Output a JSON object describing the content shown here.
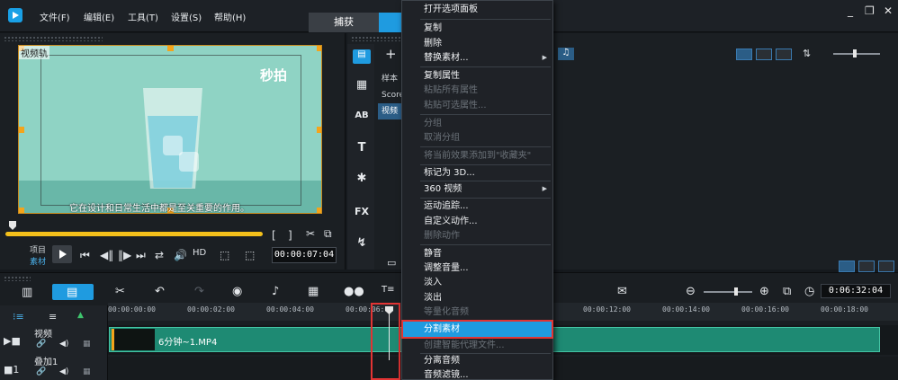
{
  "menubar": {
    "items": [
      "文件(F)",
      "编辑(E)",
      "工具(T)",
      "设置(S)",
      "帮助(H)"
    ],
    "step_tab": "捕获"
  },
  "player": {
    "track_label": "视频轨",
    "watermark": "秒拍",
    "subtitle": "它在设计和日常生活中都是至关重要的作用。",
    "mode_project": "项目",
    "mode_clip": "素材",
    "timecode": "00:00:07:04"
  },
  "library": {
    "list_items": [
      "样本",
      "Score",
      "视频"
    ],
    "selected_index": 2
  },
  "context_menu": {
    "items": [
      {
        "label": "打开选项面板",
        "disabled": false,
        "submenu": false
      },
      {
        "label": "复制",
        "disabled": false,
        "submenu": false
      },
      {
        "label": "删除",
        "disabled": false,
        "submenu": false
      },
      {
        "label": "替换素材...",
        "disabled": false,
        "submenu": true
      },
      {
        "label": "复制属性",
        "disabled": false,
        "submenu": false
      },
      {
        "label": "粘贴所有属性",
        "disabled": true,
        "submenu": false
      },
      {
        "label": "粘贴可选属性...",
        "disabled": true,
        "submenu": false
      },
      {
        "label": "分组",
        "disabled": true,
        "submenu": false
      },
      {
        "label": "取消分组",
        "disabled": true,
        "submenu": false
      },
      {
        "label": "将当前效果添加到\"收藏夹\"",
        "disabled": true,
        "submenu": false
      },
      {
        "label": "标记为 3D...",
        "disabled": false,
        "submenu": false
      },
      {
        "label": "360 视频",
        "disabled": false,
        "submenu": true
      },
      {
        "label": "运动追踪...",
        "disabled": false,
        "submenu": false
      },
      {
        "label": "自定义动作...",
        "disabled": false,
        "submenu": false
      },
      {
        "label": "删除动作",
        "disabled": true,
        "submenu": false
      },
      {
        "label": "静音",
        "disabled": false,
        "submenu": false
      },
      {
        "label": "调整音量...",
        "disabled": false,
        "submenu": false
      },
      {
        "label": "淡入",
        "disabled": false,
        "submenu": false
      },
      {
        "label": "淡出",
        "disabled": false,
        "submenu": false
      },
      {
        "label": "等量化音频",
        "disabled": true,
        "submenu": false
      },
      {
        "label": "分割素材",
        "disabled": false,
        "submenu": false,
        "highlighted": true
      },
      {
        "label": "创建智能代理文件...",
        "disabled": true,
        "submenu": false
      },
      {
        "label": "分离音频",
        "disabled": false,
        "submenu": false
      },
      {
        "label": "音频滤镜...",
        "disabled": false,
        "submenu": false
      }
    ]
  },
  "timeline": {
    "total_time": "0:06:32:04",
    "ruler_labels": [
      "00:00:00:00",
      "00:00:02:00",
      "00:00:04:00",
      "00:00:06:00",
      "00:00:12:00",
      "00:00:14:00",
      "00:00:16:00",
      "00:00:18:00"
    ],
    "tracks": [
      "视频",
      "叠加1"
    ],
    "clip_name": "6分钟~1.MP4"
  },
  "colors": {
    "accent": "#1f9be0",
    "clip": "#1e8a73",
    "highlight_border": "#e23434",
    "scrub": "#f4c01b"
  }
}
